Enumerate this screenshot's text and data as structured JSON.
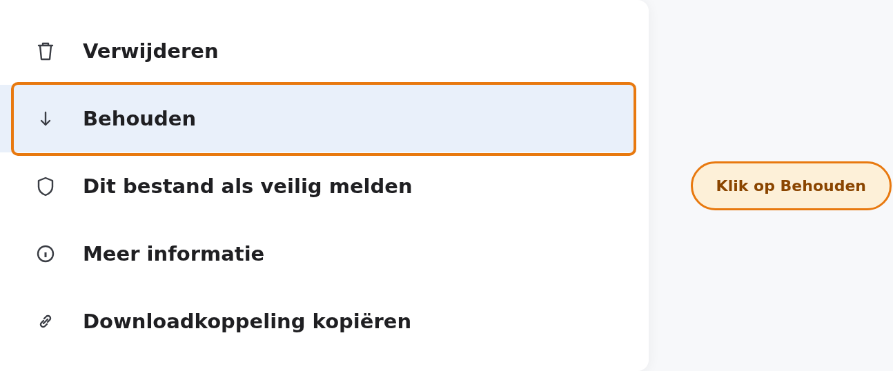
{
  "menu": {
    "items": [
      {
        "label": "Verwijderen",
        "selected": false
      },
      {
        "label": "Behouden",
        "selected": true
      },
      {
        "label": "Dit bestand als veilig melden",
        "selected": false
      },
      {
        "label": "Meer informatie",
        "selected": false
      },
      {
        "label": "Downloadkoppeling kopiëren",
        "selected": false
      }
    ]
  },
  "callout": {
    "text": "Klik op Behouden"
  }
}
